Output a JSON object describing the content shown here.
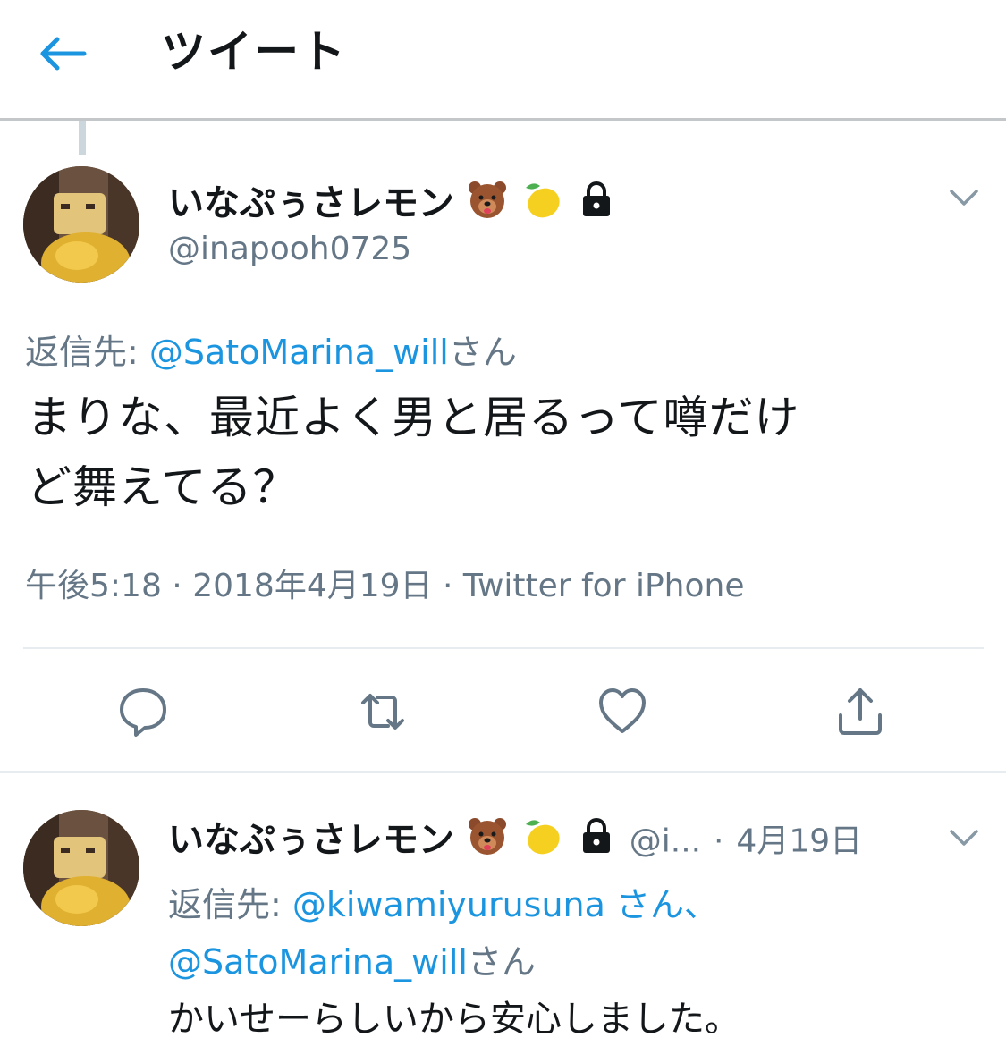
{
  "header": {
    "title": "ツイート",
    "back_icon": "arrow-left-icon",
    "accent_color": "#1b95e0"
  },
  "main_tweet": {
    "display_name": "いなぷぅさレモン",
    "handle": "@inapooh0725",
    "icons": [
      "bear-face-icon",
      "lemon-icon",
      "lock-icon"
    ],
    "reply_prefix": "返信先: ",
    "reply_to": "@SatoMarina_will",
    "reply_suffix": "さん",
    "text_line1": "まりな、最近よく男と居るって噂だけ",
    "text_line2": "ど舞えてる？",
    "time": "午後5:18",
    "date": "2018年4月19日",
    "client": "Twitter for iPhone",
    "separator": "·",
    "actions": [
      "reply-icon",
      "retweet-icon",
      "like-icon",
      "share-icon"
    ]
  },
  "reply_tweet": {
    "display_name": "いなぷぅさレモン",
    "handle_truncated": "@i...",
    "separator": "·",
    "date": "4月19日",
    "reply_prefix": "返信先: ",
    "reply_to_1": "@kiwamiyurusuna",
    "reply_mid": " さん、",
    "reply_to_2": "@SatoMarina_will",
    "reply_suffix": "さん",
    "text": "かいせーらしいから安心しました。"
  },
  "colors": {
    "text": "#14171a",
    "secondary": "#657786",
    "link": "#1b95e0",
    "divider": "#e6ecf0"
  }
}
